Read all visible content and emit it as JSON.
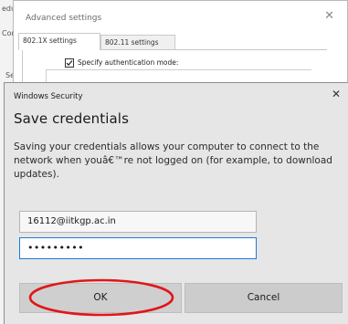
{
  "background_window": {
    "fragments": [
      "edu",
      "Con",
      "Se"
    ]
  },
  "advanced_dialog": {
    "title": "Advanced settings",
    "close_glyph": "✕",
    "tabs": [
      {
        "label": "802.1X settings",
        "active": true
      },
      {
        "label": "802.11 settings",
        "active": false
      }
    ],
    "checkbox": {
      "label": "Specify authentication mode:",
      "checked": true
    }
  },
  "security_dialog": {
    "caption": "Windows Security",
    "close_glyph": "✕",
    "heading": "Save credentials",
    "message": "Saving your credentials allows your computer to connect to the network when youâ€™re not logged on (for example, to download updates).",
    "username_value": "16112@iitkgp.ac.in",
    "password_value": "•••••••••",
    "ok_label": "OK",
    "cancel_label": "Cancel",
    "annotation_color": "#e0161b"
  },
  "colors": {
    "dialog_bg": "#e6e6e6",
    "focus_border": "#1f7bd6",
    "button_bg": "#cccccc"
  }
}
